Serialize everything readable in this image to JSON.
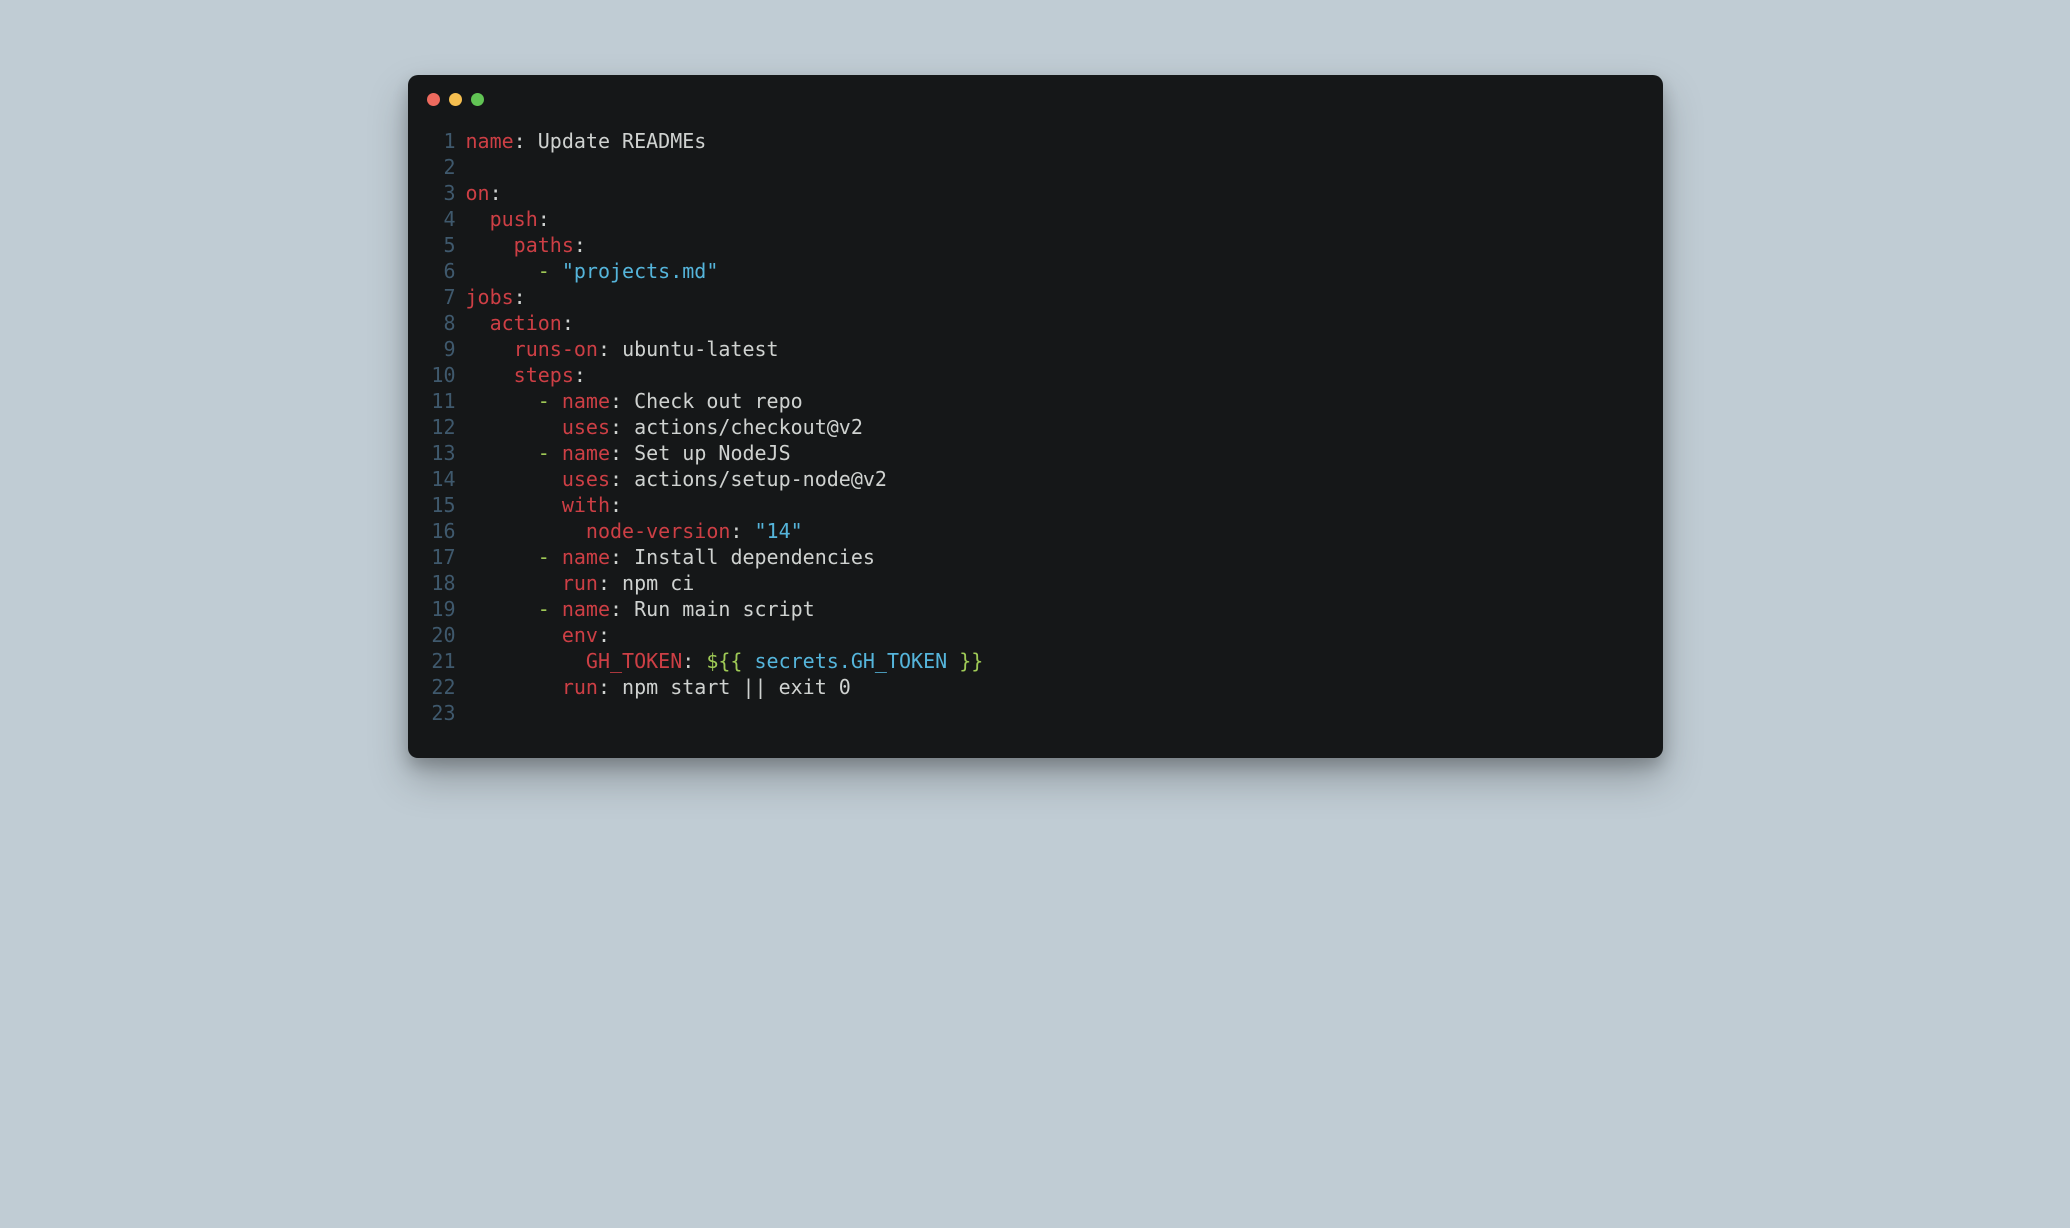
{
  "traffic_lights": {
    "close": "#ed6a5e",
    "minimize": "#f5be4f",
    "zoom": "#61c454"
  },
  "code": {
    "lines": [
      {
        "n": 1,
        "segs": [
          {
            "t": "name",
            "c": "key"
          },
          {
            "t": ": ",
            "c": "val"
          },
          {
            "t": "Update READMEs",
            "c": "val"
          }
        ]
      },
      {
        "n": 2,
        "segs": []
      },
      {
        "n": 3,
        "segs": [
          {
            "t": "on",
            "c": "key"
          },
          {
            "t": ":",
            "c": "val"
          }
        ]
      },
      {
        "n": 4,
        "segs": [
          {
            "t": "  ",
            "c": "val"
          },
          {
            "t": "push",
            "c": "key"
          },
          {
            "t": ":",
            "c": "val"
          }
        ]
      },
      {
        "n": 5,
        "segs": [
          {
            "t": "    ",
            "c": "val"
          },
          {
            "t": "paths",
            "c": "key"
          },
          {
            "t": ":",
            "c": "val"
          }
        ]
      },
      {
        "n": 6,
        "segs": [
          {
            "t": "      ",
            "c": "val"
          },
          {
            "t": "-",
            "c": "dash"
          },
          {
            "t": " ",
            "c": "val"
          },
          {
            "t": "\"projects.md\"",
            "c": "str"
          }
        ]
      },
      {
        "n": 7,
        "segs": [
          {
            "t": "jobs",
            "c": "key"
          },
          {
            "t": ":",
            "c": "val"
          }
        ]
      },
      {
        "n": 8,
        "segs": [
          {
            "t": "  ",
            "c": "val"
          },
          {
            "t": "action",
            "c": "key"
          },
          {
            "t": ":",
            "c": "val"
          }
        ]
      },
      {
        "n": 9,
        "segs": [
          {
            "t": "    ",
            "c": "val"
          },
          {
            "t": "runs-on",
            "c": "key"
          },
          {
            "t": ": ",
            "c": "val"
          },
          {
            "t": "ubuntu-latest",
            "c": "val"
          }
        ]
      },
      {
        "n": 10,
        "segs": [
          {
            "t": "    ",
            "c": "val"
          },
          {
            "t": "steps",
            "c": "key"
          },
          {
            "t": ":",
            "c": "val"
          }
        ]
      },
      {
        "n": 11,
        "segs": [
          {
            "t": "      ",
            "c": "val"
          },
          {
            "t": "-",
            "c": "dash"
          },
          {
            "t": " ",
            "c": "val"
          },
          {
            "t": "name",
            "c": "key"
          },
          {
            "t": ": ",
            "c": "val"
          },
          {
            "t": "Check out repo",
            "c": "val"
          }
        ]
      },
      {
        "n": 12,
        "segs": [
          {
            "t": "        ",
            "c": "val"
          },
          {
            "t": "uses",
            "c": "key"
          },
          {
            "t": ": ",
            "c": "val"
          },
          {
            "t": "actions/checkout@v2",
            "c": "val"
          }
        ]
      },
      {
        "n": 13,
        "segs": [
          {
            "t": "      ",
            "c": "val"
          },
          {
            "t": "-",
            "c": "dash"
          },
          {
            "t": " ",
            "c": "val"
          },
          {
            "t": "name",
            "c": "key"
          },
          {
            "t": ": ",
            "c": "val"
          },
          {
            "t": "Set up NodeJS",
            "c": "val"
          }
        ]
      },
      {
        "n": 14,
        "segs": [
          {
            "t": "        ",
            "c": "val"
          },
          {
            "t": "uses",
            "c": "key"
          },
          {
            "t": ": ",
            "c": "val"
          },
          {
            "t": "actions/setup-node@v2",
            "c": "val"
          }
        ]
      },
      {
        "n": 15,
        "segs": [
          {
            "t": "        ",
            "c": "val"
          },
          {
            "t": "with",
            "c": "key"
          },
          {
            "t": ":",
            "c": "val"
          }
        ]
      },
      {
        "n": 16,
        "segs": [
          {
            "t": "          ",
            "c": "val"
          },
          {
            "t": "node-version",
            "c": "key"
          },
          {
            "t": ": ",
            "c": "val"
          },
          {
            "t": "\"14\"",
            "c": "str"
          }
        ]
      },
      {
        "n": 17,
        "segs": [
          {
            "t": "      ",
            "c": "val"
          },
          {
            "t": "-",
            "c": "dash"
          },
          {
            "t": " ",
            "c": "val"
          },
          {
            "t": "name",
            "c": "key"
          },
          {
            "t": ": ",
            "c": "val"
          },
          {
            "t": "Install dependencies",
            "c": "val"
          }
        ]
      },
      {
        "n": 18,
        "segs": [
          {
            "t": "        ",
            "c": "val"
          },
          {
            "t": "run",
            "c": "key"
          },
          {
            "t": ": ",
            "c": "val"
          },
          {
            "t": "npm ci",
            "c": "val"
          }
        ]
      },
      {
        "n": 19,
        "segs": [
          {
            "t": "      ",
            "c": "val"
          },
          {
            "t": "-",
            "c": "dash"
          },
          {
            "t": " ",
            "c": "val"
          },
          {
            "t": "name",
            "c": "key"
          },
          {
            "t": ": ",
            "c": "val"
          },
          {
            "t": "Run main script",
            "c": "val"
          }
        ]
      },
      {
        "n": 20,
        "segs": [
          {
            "t": "        ",
            "c": "val"
          },
          {
            "t": "env",
            "c": "key"
          },
          {
            "t": ":",
            "c": "val"
          }
        ]
      },
      {
        "n": 21,
        "segs": [
          {
            "t": "          ",
            "c": "val"
          },
          {
            "t": "GH_TOKEN",
            "c": "key"
          },
          {
            "t": ": ",
            "c": "val"
          },
          {
            "t": "${{",
            "c": "punct"
          },
          {
            "t": " secrets.GH_TOKEN ",
            "c": "str"
          },
          {
            "t": "}}",
            "c": "punct"
          }
        ]
      },
      {
        "n": 22,
        "segs": [
          {
            "t": "        ",
            "c": "val"
          },
          {
            "t": "run",
            "c": "key"
          },
          {
            "t": ": ",
            "c": "val"
          },
          {
            "t": "npm start || exit 0",
            "c": "val"
          }
        ]
      },
      {
        "n": 23,
        "segs": []
      }
    ]
  }
}
